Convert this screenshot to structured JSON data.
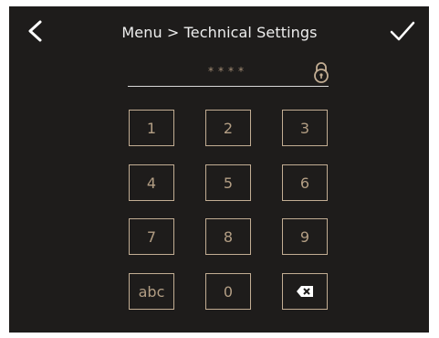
{
  "header": {
    "title": "Menu > Technical Settings",
    "back_icon": "chevron-left-icon",
    "confirm_icon": "checkmark-icon"
  },
  "pin": {
    "masked_value": "****",
    "lock_icon": "padlock-icon"
  },
  "keypad": {
    "keys": [
      "1",
      "2",
      "3",
      "4",
      "5",
      "6",
      "7",
      "8",
      "9",
      "abc",
      "0"
    ],
    "backspace_icon": "backspace-icon"
  },
  "colors": {
    "background": "#1e1c1b",
    "accent": "#c2ad93",
    "key_text": "#b39e84",
    "title_text": "#eeeeee"
  }
}
